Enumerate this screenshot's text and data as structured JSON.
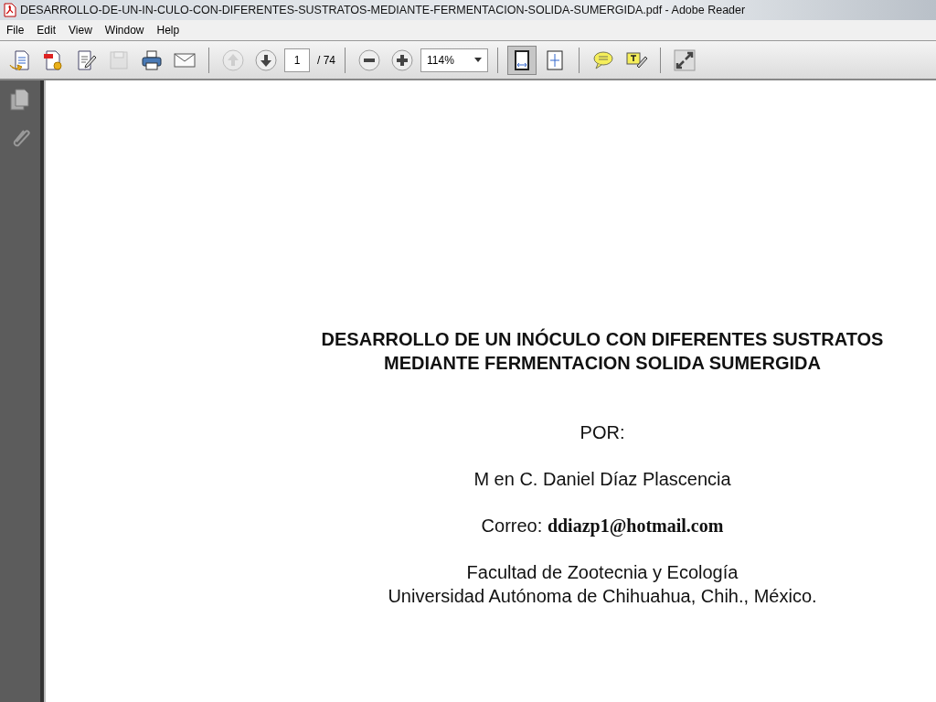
{
  "window": {
    "title": "DESARROLLO-DE-UN-IN-CULO-CON-DIFERENTES-SUSTRATOS-MEDIANTE-FERMENTACION-SOLIDA-SUMERGIDA.pdf - Adobe Reader"
  },
  "menu": [
    "File",
    "Edit",
    "View",
    "Window",
    "Help"
  ],
  "toolbar": [
    {
      "kind": "create",
      "disabled": false,
      "selected": false
    },
    {
      "kind": "convert",
      "disabled": false,
      "selected": false
    },
    {
      "kind": "edit",
      "disabled": false,
      "selected": false
    },
    {
      "kind": "save",
      "disabled": true,
      "selected": false
    },
    {
      "kind": "print",
      "disabled": false,
      "selected": false
    },
    {
      "kind": "mail",
      "disabled": false,
      "selected": false
    },
    {
      "kind": "sep"
    },
    {
      "kind": "prev",
      "disabled": true,
      "selected": false
    },
    {
      "kind": "next",
      "disabled": false,
      "selected": false
    },
    {
      "kind": "page"
    },
    {
      "kind": "sep"
    },
    {
      "kind": "zoomout",
      "disabled": false,
      "selected": false
    },
    {
      "kind": "zoomin",
      "disabled": false,
      "selected": false
    },
    {
      "kind": "zoom"
    },
    {
      "kind": "sep"
    },
    {
      "kind": "fitwidth",
      "disabled": false,
      "selected": true
    },
    {
      "kind": "fitpage",
      "disabled": false,
      "selected": false
    },
    {
      "kind": "sep"
    },
    {
      "kind": "comment",
      "disabled": false,
      "selected": false
    },
    {
      "kind": "highlight",
      "disabled": false,
      "selected": false
    },
    {
      "kind": "sep"
    },
    {
      "kind": "fullscreen",
      "disabled": false,
      "selected": false
    }
  ],
  "page_field": {
    "value": "1",
    "total": "/ 74"
  },
  "zoom_field": {
    "value": "114%"
  },
  "document": {
    "title_lines": [
      "DESARROLLO DE UN INÓCULO CON DIFERENTES SUSTRATOS",
      "MEDIANTE FERMENTACION SOLIDA SUMERGIDA"
    ],
    "by": "POR:",
    "author": "M en C. Daniel Díaz Plascencia",
    "email_label": "Correo:",
    "email": "ddiazp1@hotmail.com",
    "affiliation": [
      "Facultad de Zootecnia y Ecología",
      "Universidad Autónoma de Chihuahua, Chih.,  México."
    ]
  }
}
